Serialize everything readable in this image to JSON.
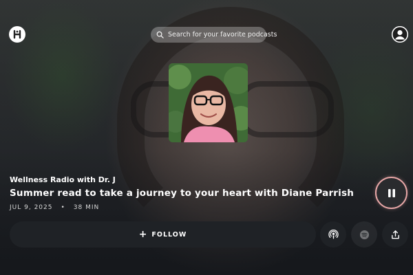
{
  "header": {
    "search_placeholder": "Search for your favorite podcasts",
    "logo_icon": "logo-icon",
    "account_icon": "account-icon"
  },
  "episode": {
    "show_name": "Wellness Radio with Dr. J",
    "title": "Summer read to take a journey to your heart with Diane Parrish",
    "date": "JUL 9, 2025",
    "separator": "•",
    "duration": "38 MIN"
  },
  "controls": {
    "play_state": "playing",
    "pause_icon": "pause-icon",
    "follow_label": "FOLLOW",
    "follow_icon": "plus",
    "apple_podcasts_icon": "podcast-icon",
    "spotify_icon": "spotify-icon",
    "share_icon": "share-icon"
  },
  "colors": {
    "accent": "#e8a7a7",
    "button_bg": "#1f2226"
  }
}
